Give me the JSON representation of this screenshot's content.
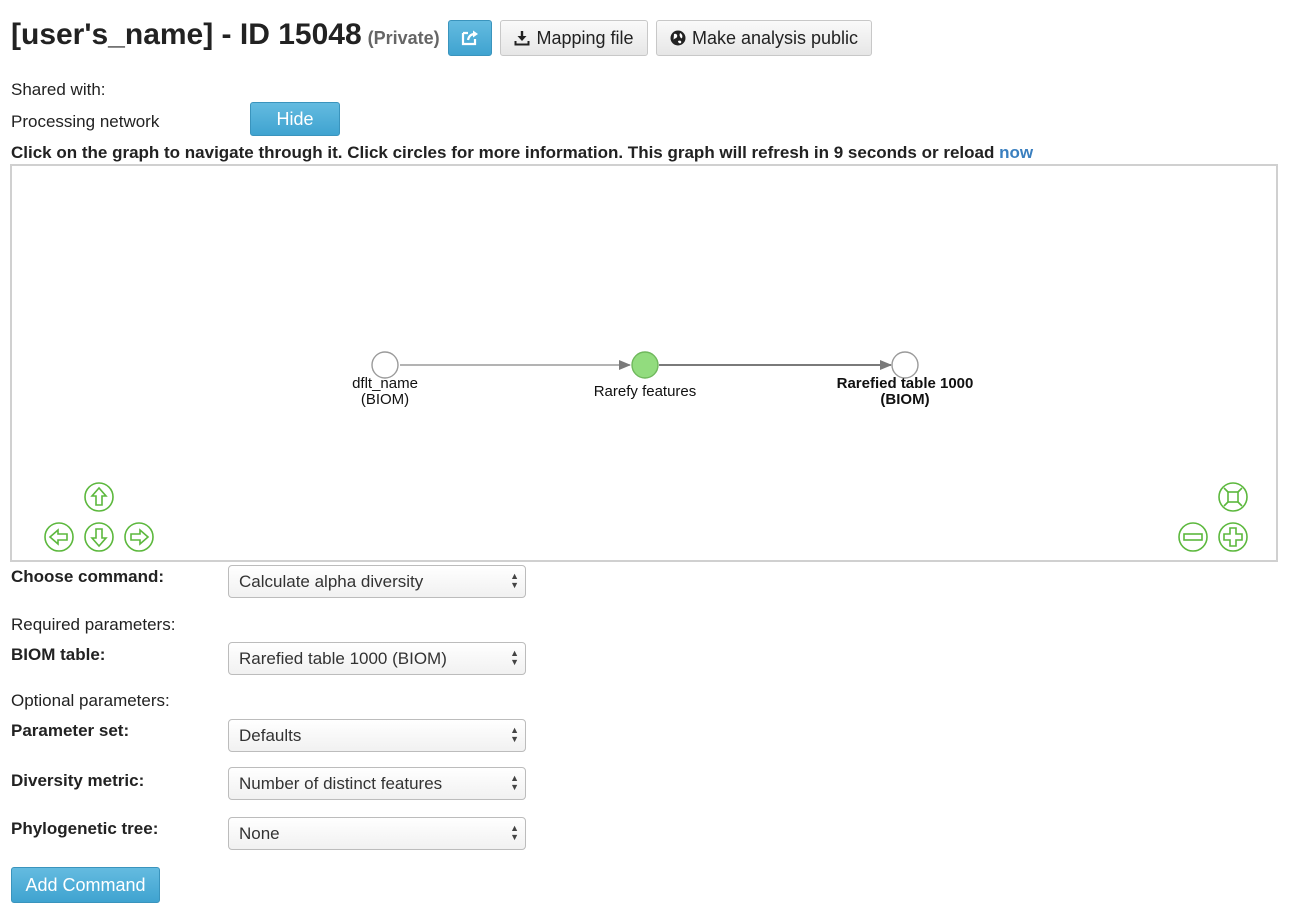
{
  "header": {
    "title": "[user's_name] - ID 15048",
    "visibility": "(Private)",
    "share_icon": "share-icon",
    "mapping_label": "Mapping file",
    "public_label": "Make analysis public"
  },
  "shared_with_label": "Shared with:",
  "network": {
    "label": "Processing network",
    "toggle_label": "Hide"
  },
  "instructions": {
    "text": "Click on the graph to navigate through it. Click circles for more information. This graph will refresh in 9 seconds or reload",
    "reload_link": "now"
  },
  "graph": {
    "nodes": [
      {
        "label_line1": "dflt_name",
        "label_line2": "(BIOM)",
        "fill": "#ffffff"
      },
      {
        "label_line1": "Rarefy features",
        "label_line2": "",
        "fill": "#92dc7e"
      },
      {
        "label_line1": "Rarefied table 1000",
        "label_line2": "(BIOM)",
        "fill": "#ffffff"
      }
    ],
    "nav_color": "#5cb83d"
  },
  "form": {
    "choose_command_label": "Choose command:",
    "choose_command_value": "Calculate alpha diversity",
    "required_label": "Required parameters:",
    "biom_label": "BIOM table:",
    "biom_value": "Rarefied table 1000 (BIOM)",
    "optional_label": "Optional parameters:",
    "param_set_label": "Parameter set:",
    "param_set_value": "Defaults",
    "metric_label": "Diversity metric:",
    "metric_value": "Number of distinct features",
    "tree_label": "Phylogenetic tree:",
    "tree_value": "None",
    "add_label": "Add Command"
  },
  "colors": {
    "accent": "#4aa9d4",
    "link": "#3a7fbf"
  }
}
